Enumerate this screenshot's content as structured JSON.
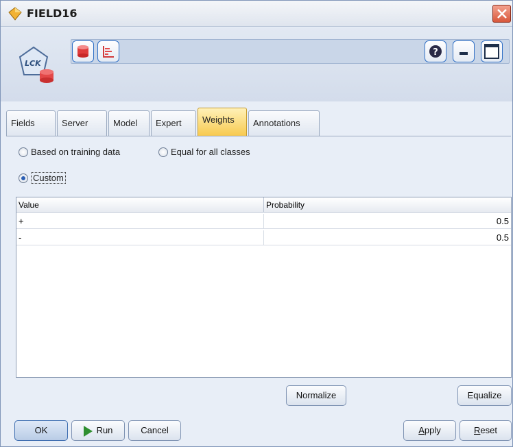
{
  "window": {
    "title": "FIELD16"
  },
  "tabs": [
    {
      "label": "Fields"
    },
    {
      "label": "Server"
    },
    {
      "label": "Model"
    },
    {
      "label": "Expert"
    },
    {
      "label": "Weights",
      "active": true
    },
    {
      "label": "Annotations"
    }
  ],
  "weights": {
    "options": [
      {
        "label": "Based on training data",
        "checked": false
      },
      {
        "label": "Equal for all classes",
        "checked": false
      },
      {
        "label": "Custom",
        "checked": true
      }
    ],
    "table": {
      "columns": [
        "Value",
        "Probability"
      ],
      "rows": [
        {
          "value": "+",
          "probability": "0.5"
        },
        {
          "value": "-",
          "probability": "0.5"
        }
      ]
    },
    "normalize_label": "Normalize",
    "equalize_label": "Equalize"
  },
  "footer": {
    "ok_label": "OK",
    "run_label": "Run",
    "cancel_label": "Cancel",
    "apply_label": "Apply",
    "reset_label": "Reset"
  },
  "colors": {
    "active_tab": "#f7c94d",
    "accent": "#2f6fc5",
    "close": "#d8573b"
  }
}
